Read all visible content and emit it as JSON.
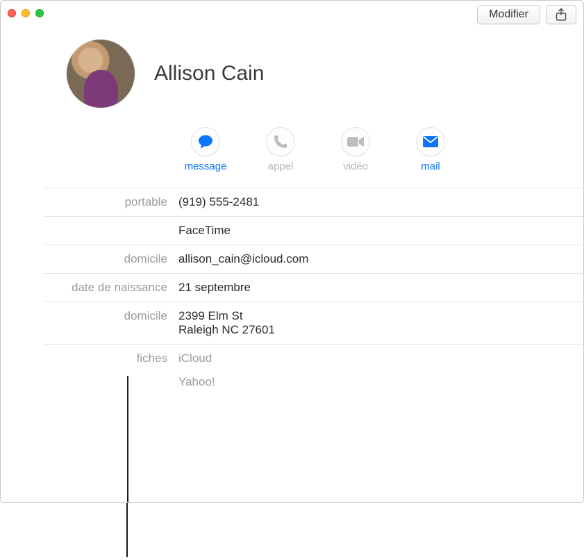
{
  "toolbar": {
    "modify_label": "Modifier"
  },
  "contact": {
    "name": "Allison Cain"
  },
  "actions": {
    "message": "message",
    "call": "appel",
    "video": "vidéo",
    "mail": "mail"
  },
  "fields": {
    "mobile_label": "portable",
    "mobile_value": "(919) 555-2481",
    "facetime_value": "FaceTime",
    "home_email_label": "domicile",
    "home_email_value": "allison_cain@icloud.com",
    "birthday_label": "date de naissance",
    "birthday_value": "21 septembre",
    "home_addr_label": "domicile",
    "home_addr_line1": "2399 Elm St",
    "home_addr_line2": "Raleigh NC 27601",
    "cards_label": "fiches",
    "cards_value1": "iCloud",
    "cards_value2": "Yahoo!"
  }
}
